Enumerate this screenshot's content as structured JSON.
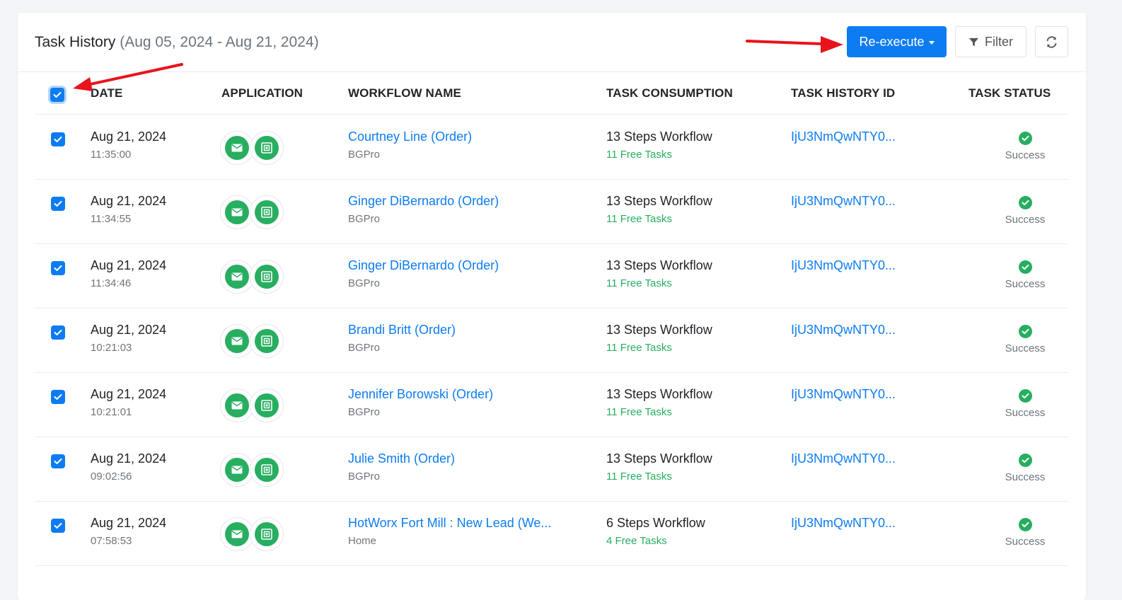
{
  "header": {
    "title": "Task History",
    "date_range": "(Aug 05, 2024 - Aug 21, 2024)",
    "reexecute_label": "Re-execute",
    "filter_label": "Filter"
  },
  "columns": {
    "date": "DATE",
    "application": "APPLICATION",
    "workflow_name": "WORKFLOW NAME",
    "task_consumption": "TASK CONSUMPTION",
    "task_history_id": "TASK HISTORY ID",
    "task_status": "TASK STATUS"
  },
  "rows": [
    {
      "date": "Aug 21, 2024",
      "time": "11:35:00",
      "workflow": "Courtney Line (Order)",
      "folder": "BGPro",
      "steps": "13 Steps Workflow",
      "free": "11 Free Tasks",
      "history_id": "IjU3NmQwNTY0...",
      "status": "Success"
    },
    {
      "date": "Aug 21, 2024",
      "time": "11:34:55",
      "workflow": "Ginger DiBernardo (Order)",
      "folder": "BGPro",
      "steps": "13 Steps Workflow",
      "free": "11 Free Tasks",
      "history_id": "IjU3NmQwNTY0...",
      "status": "Success"
    },
    {
      "date": "Aug 21, 2024",
      "time": "11:34:46",
      "workflow": "Ginger DiBernardo (Order)",
      "folder": "BGPro",
      "steps": "13 Steps Workflow",
      "free": "11 Free Tasks",
      "history_id": "IjU3NmQwNTY0...",
      "status": "Success"
    },
    {
      "date": "Aug 21, 2024",
      "time": "10:21:03",
      "workflow": "Brandi Britt (Order)",
      "folder": "BGPro",
      "steps": "13 Steps Workflow",
      "free": "11 Free Tasks",
      "history_id": "IjU3NmQwNTY0...",
      "status": "Success"
    },
    {
      "date": "Aug 21, 2024",
      "time": "10:21:01",
      "workflow": "Jennifer Borowski (Order)",
      "folder": "BGPro",
      "steps": "13 Steps Workflow",
      "free": "11 Free Tasks",
      "history_id": "IjU3NmQwNTY0...",
      "status": "Success"
    },
    {
      "date": "Aug 21, 2024",
      "time": "09:02:56",
      "workflow": "Julie Smith (Order)",
      "folder": "BGPro",
      "steps": "13 Steps Workflow",
      "free": "11 Free Tasks",
      "history_id": "IjU3NmQwNTY0...",
      "status": "Success"
    },
    {
      "date": "Aug 21, 2024",
      "time": "07:58:53",
      "workflow": "HotWorx Fort Mill : New Lead (We...",
      "folder": "Home",
      "steps": "6 Steps Workflow",
      "free": "4 Free Tasks",
      "history_id": "IjU3NmQwNTY0...",
      "status": "Success"
    }
  ],
  "colors": {
    "primary": "#0d7cf2",
    "success": "#27ae60",
    "annotation_arrow": "#e8141b"
  },
  "icons": {
    "app_1": "email-icon",
    "app_2": "app-frame-icon",
    "status": "check-circle-icon",
    "filter": "filter-icon",
    "refresh": "refresh-icon"
  }
}
